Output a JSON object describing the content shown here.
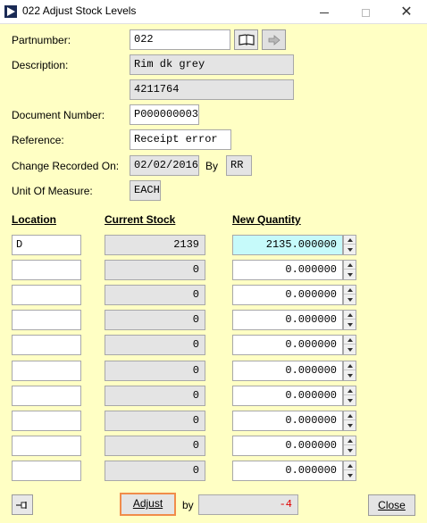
{
  "window": {
    "title": "022 Adjust Stock Levels"
  },
  "form": {
    "partnumber_label": "Partnumber:",
    "partnumber_value": "022",
    "description_label": "Description:",
    "description_value": "Rim dk grey",
    "description2_value": "4211764",
    "docnum_label": "Document Number:",
    "docnum_value": "P000000003",
    "reference_label": "Reference:",
    "reference_value": "Receipt error",
    "changed_label": "Change Recorded On:",
    "changed_date": "02/02/2016",
    "by_label": "By",
    "changed_by": "RR",
    "uom_label": "Unit Of Measure:",
    "uom_value": "EACH"
  },
  "grid": {
    "headers": {
      "location": "Location",
      "current": "Current Stock",
      "newqty": "New Quantity"
    },
    "rows": [
      {
        "location": "D",
        "current": "2139",
        "newqty": "2135.000000"
      },
      {
        "location": "",
        "current": "0",
        "newqty": "0.000000"
      },
      {
        "location": "",
        "current": "0",
        "newqty": "0.000000"
      },
      {
        "location": "",
        "current": "0",
        "newqty": "0.000000"
      },
      {
        "location": "",
        "current": "0",
        "newqty": "0.000000"
      },
      {
        "location": "",
        "current": "0",
        "newqty": "0.000000"
      },
      {
        "location": "",
        "current": "0",
        "newqty": "0.000000"
      },
      {
        "location": "",
        "current": "0",
        "newqty": "0.000000"
      },
      {
        "location": "",
        "current": "0",
        "newqty": "0.000000"
      },
      {
        "location": "",
        "current": "0",
        "newqty": "0.000000"
      }
    ]
  },
  "footer": {
    "adjust_label": "Adjust",
    "by_label": "by",
    "adjust_amount": "-4",
    "close_label": "Close"
  },
  "colors": {
    "background": "#ffffc4",
    "highlight": "#c6fafa",
    "negative": "#e00000",
    "focus_border": "#f08c4a"
  }
}
